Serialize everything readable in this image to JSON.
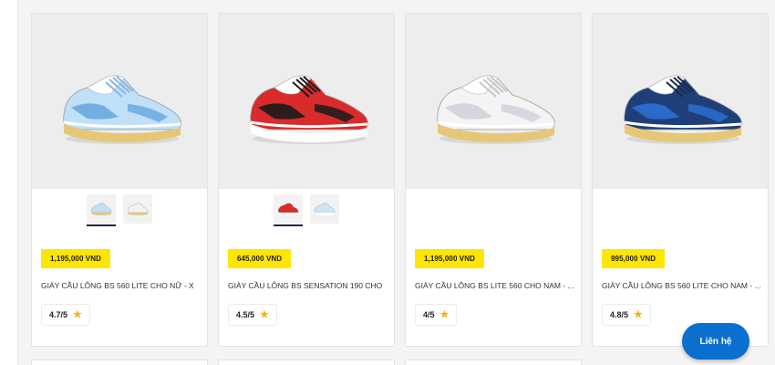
{
  "products": [
    {
      "price": "1,195,000 VND",
      "name": "GIÀY CẦU LÔNG BS 560 LITE CHO NỮ - X",
      "rating": "4.7/5",
      "image_icon": "shoe-light-blue-icon",
      "colors": {
        "upper": "#bfe0f6",
        "accent": "#6aa9e0",
        "sole": "#e6c777",
        "trim": "#ffffff",
        "lace": "#8ab6df"
      },
      "thumbnails": [
        {
          "icon": "shoe-light-blue-thumb-icon",
          "upper": "#bfe0f6",
          "sole": "#e6c777",
          "active": true
        },
        {
          "icon": "shoe-white-thumb-icon",
          "upper": "#f2f2f2",
          "sole": "#e6c777",
          "active": false
        }
      ]
    },
    {
      "price": "645,000 VND",
      "name": "GIÀY CẦU LÔNG BS SENSATION 190 CHO",
      "rating": "4.5/5",
      "image_icon": "shoe-red-black-icon",
      "colors": {
        "upper": "#d92b2b",
        "accent": "#1b1b1b",
        "sole": "#ffffff",
        "trim": "#ffffff",
        "lace": "#1b1b1b"
      },
      "thumbnails": [
        {
          "icon": "shoe-red-thumb-icon",
          "upper": "#d92b2b",
          "sole": "#ffffff",
          "active": true
        },
        {
          "icon": "shoe-light-blue-thumb-icon",
          "upper": "#cfe4f5",
          "sole": "#ffffff",
          "active": false
        }
      ]
    },
    {
      "price": "1,195,000 VND",
      "name": "GIÀY CẦU LÔNG BS LITE 560 CHO NAM - ...",
      "rating": "4/5",
      "image_icon": "shoe-white-icon",
      "colors": {
        "upper": "#f4f4f4",
        "accent": "#cfd3da",
        "sole": "#e6c777",
        "trim": "#ffffff",
        "lace": "#c6c6c6"
      },
      "thumbnails": []
    },
    {
      "price": "995,000 VND",
      "name": "GIÀY CẦU LÔNG BS 560 LITE CHO NAM - ...",
      "rating": "4.8/5",
      "image_icon": "shoe-navy-blue-icon",
      "colors": {
        "upper": "#1f3f7a",
        "accent": "#2d6fd1",
        "sole": "#e6c777",
        "trim": "#ffffff",
        "lace": "#1a2a4a"
      },
      "thumbnails": []
    }
  ],
  "contact_button": "Liên hệ"
}
